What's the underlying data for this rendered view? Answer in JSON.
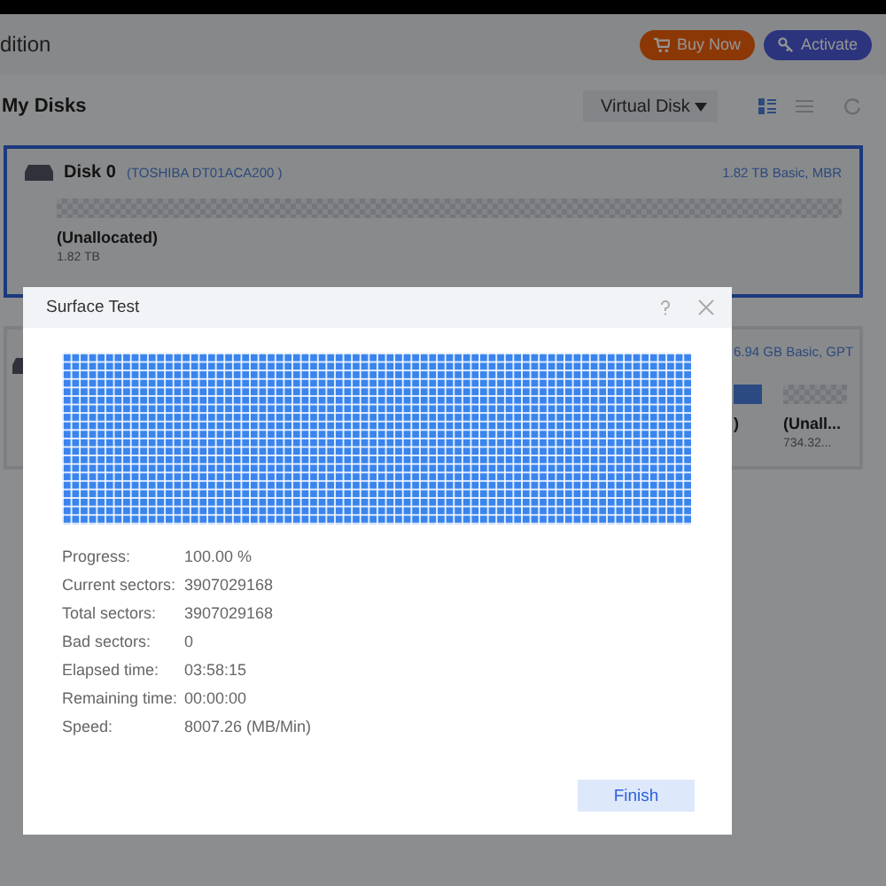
{
  "app": {
    "title": "dition",
    "buttons": [
      {
        "label": "Buy Now",
        "kind": "buy"
      },
      {
        "label": "Activate",
        "kind": "activate"
      }
    ]
  },
  "disks_panel": {
    "title": "My Disks",
    "view_dropdown": "Virtual Disk"
  },
  "disks": [
    {
      "name": "Disk 0",
      "model": "(TOSHIBA DT01ACA200 )",
      "summary": "1.82 TB Basic, MBR",
      "selected": true,
      "partitions": [
        {
          "kind": "unallocated",
          "label": "(Unallocated)",
          "size": "1.82 TB"
        }
      ]
    },
    {
      "summary": "6.94 GB Basic, GPT",
      "selected": false,
      "partitions": [
        {
          "kind": "primary",
          "label": ")"
        },
        {
          "kind": "unallocated",
          "label": "(Unall...",
          "size": "734.32..."
        }
      ]
    }
  ],
  "dialog": {
    "title": "Surface Test",
    "stats": [
      {
        "label": "Progress:",
        "value": "100.00 %"
      },
      {
        "label": "Current sectors:",
        "value": "3907029168"
      },
      {
        "label": "Total sectors:",
        "value": "3907029168"
      },
      {
        "label": "Bad sectors:",
        "value": "0"
      },
      {
        "label": "Elapsed time:",
        "value": "03:58:15"
      },
      {
        "label": "Remaining time:",
        "value": "00:00:00"
      },
      {
        "label": "Speed:",
        "value": "8007.26 (MB/Min)"
      }
    ],
    "button": "Finish"
  }
}
